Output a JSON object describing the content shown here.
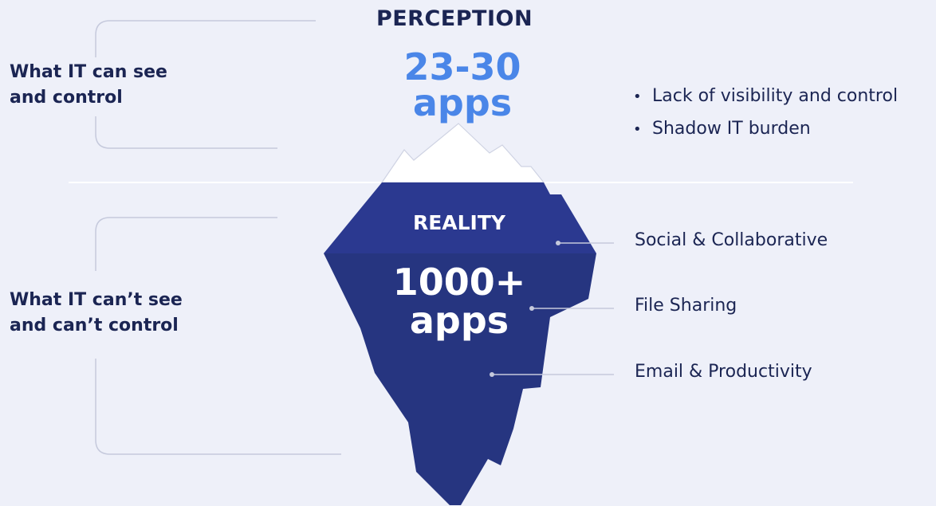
{
  "perception": {
    "heading": "PERCEPTION",
    "count_line1": "23-30",
    "count_line2": "apps",
    "left_label_line1": "What IT can see",
    "left_label_line2": "and control",
    "bullets": [
      "Lack of visibility and control",
      "Shadow IT burden"
    ]
  },
  "reality": {
    "heading": "REALITY",
    "count_line1": "1000+",
    "count_line2": "apps",
    "left_label_line1": "What IT can’t see",
    "left_label_line2": "and can’t control",
    "categories": [
      "Social & Collaborative",
      "File Sharing",
      "Email & Productivity"
    ]
  },
  "colors": {
    "background": "#eef0f9",
    "text": "#1b2553",
    "accent": "#4a86e8",
    "iceberg_top": "#2b3990",
    "iceberg_bottom": "#263580",
    "snow": "#ffffff"
  }
}
